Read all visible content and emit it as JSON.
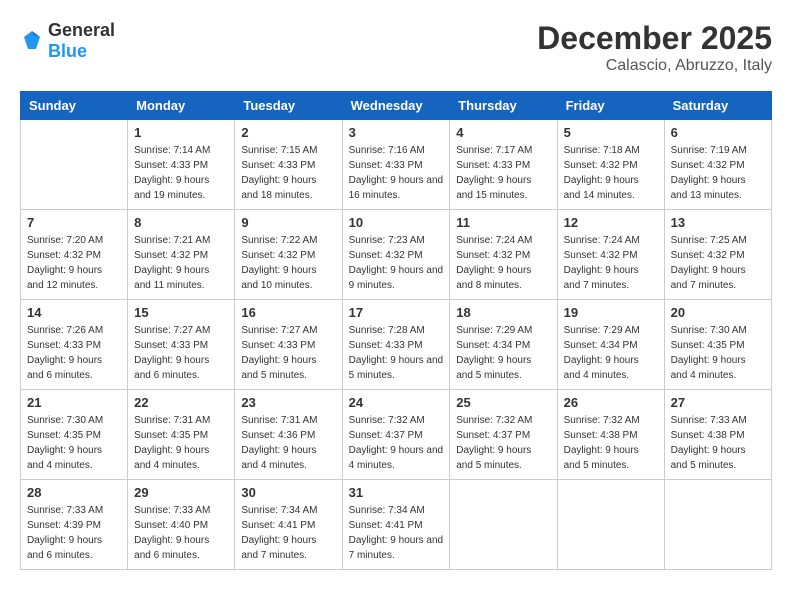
{
  "logo": {
    "general": "General",
    "blue": "Blue"
  },
  "title": "December 2025",
  "location": "Calascio, Abruzzo, Italy",
  "days_of_week": [
    "Sunday",
    "Monday",
    "Tuesday",
    "Wednesday",
    "Thursday",
    "Friday",
    "Saturday"
  ],
  "weeks": [
    [
      {
        "day": "",
        "sunrise": "",
        "sunset": "",
        "daylight": ""
      },
      {
        "day": "1",
        "sunrise": "Sunrise: 7:14 AM",
        "sunset": "Sunset: 4:33 PM",
        "daylight": "Daylight: 9 hours and 19 minutes."
      },
      {
        "day": "2",
        "sunrise": "Sunrise: 7:15 AM",
        "sunset": "Sunset: 4:33 PM",
        "daylight": "Daylight: 9 hours and 18 minutes."
      },
      {
        "day": "3",
        "sunrise": "Sunrise: 7:16 AM",
        "sunset": "Sunset: 4:33 PM",
        "daylight": "Daylight: 9 hours and 16 minutes."
      },
      {
        "day": "4",
        "sunrise": "Sunrise: 7:17 AM",
        "sunset": "Sunset: 4:33 PM",
        "daylight": "Daylight: 9 hours and 15 minutes."
      },
      {
        "day": "5",
        "sunrise": "Sunrise: 7:18 AM",
        "sunset": "Sunset: 4:32 PM",
        "daylight": "Daylight: 9 hours and 14 minutes."
      },
      {
        "day": "6",
        "sunrise": "Sunrise: 7:19 AM",
        "sunset": "Sunset: 4:32 PM",
        "daylight": "Daylight: 9 hours and 13 minutes."
      }
    ],
    [
      {
        "day": "7",
        "sunrise": "Sunrise: 7:20 AM",
        "sunset": "Sunset: 4:32 PM",
        "daylight": "Daylight: 9 hours and 12 minutes."
      },
      {
        "day": "8",
        "sunrise": "Sunrise: 7:21 AM",
        "sunset": "Sunset: 4:32 PM",
        "daylight": "Daylight: 9 hours and 11 minutes."
      },
      {
        "day": "9",
        "sunrise": "Sunrise: 7:22 AM",
        "sunset": "Sunset: 4:32 PM",
        "daylight": "Daylight: 9 hours and 10 minutes."
      },
      {
        "day": "10",
        "sunrise": "Sunrise: 7:23 AM",
        "sunset": "Sunset: 4:32 PM",
        "daylight": "Daylight: 9 hours and 9 minutes."
      },
      {
        "day": "11",
        "sunrise": "Sunrise: 7:24 AM",
        "sunset": "Sunset: 4:32 PM",
        "daylight": "Daylight: 9 hours and 8 minutes."
      },
      {
        "day": "12",
        "sunrise": "Sunrise: 7:24 AM",
        "sunset": "Sunset: 4:32 PM",
        "daylight": "Daylight: 9 hours and 7 minutes."
      },
      {
        "day": "13",
        "sunrise": "Sunrise: 7:25 AM",
        "sunset": "Sunset: 4:32 PM",
        "daylight": "Daylight: 9 hours and 7 minutes."
      }
    ],
    [
      {
        "day": "14",
        "sunrise": "Sunrise: 7:26 AM",
        "sunset": "Sunset: 4:33 PM",
        "daylight": "Daylight: 9 hours and 6 minutes."
      },
      {
        "day": "15",
        "sunrise": "Sunrise: 7:27 AM",
        "sunset": "Sunset: 4:33 PM",
        "daylight": "Daylight: 9 hours and 6 minutes."
      },
      {
        "day": "16",
        "sunrise": "Sunrise: 7:27 AM",
        "sunset": "Sunset: 4:33 PM",
        "daylight": "Daylight: 9 hours and 5 minutes."
      },
      {
        "day": "17",
        "sunrise": "Sunrise: 7:28 AM",
        "sunset": "Sunset: 4:33 PM",
        "daylight": "Daylight: 9 hours and 5 minutes."
      },
      {
        "day": "18",
        "sunrise": "Sunrise: 7:29 AM",
        "sunset": "Sunset: 4:34 PM",
        "daylight": "Daylight: 9 hours and 5 minutes."
      },
      {
        "day": "19",
        "sunrise": "Sunrise: 7:29 AM",
        "sunset": "Sunset: 4:34 PM",
        "daylight": "Daylight: 9 hours and 4 minutes."
      },
      {
        "day": "20",
        "sunrise": "Sunrise: 7:30 AM",
        "sunset": "Sunset: 4:35 PM",
        "daylight": "Daylight: 9 hours and 4 minutes."
      }
    ],
    [
      {
        "day": "21",
        "sunrise": "Sunrise: 7:30 AM",
        "sunset": "Sunset: 4:35 PM",
        "daylight": "Daylight: 9 hours and 4 minutes."
      },
      {
        "day": "22",
        "sunrise": "Sunrise: 7:31 AM",
        "sunset": "Sunset: 4:35 PM",
        "daylight": "Daylight: 9 hours and 4 minutes."
      },
      {
        "day": "23",
        "sunrise": "Sunrise: 7:31 AM",
        "sunset": "Sunset: 4:36 PM",
        "daylight": "Daylight: 9 hours and 4 minutes."
      },
      {
        "day": "24",
        "sunrise": "Sunrise: 7:32 AM",
        "sunset": "Sunset: 4:37 PM",
        "daylight": "Daylight: 9 hours and 4 minutes."
      },
      {
        "day": "25",
        "sunrise": "Sunrise: 7:32 AM",
        "sunset": "Sunset: 4:37 PM",
        "daylight": "Daylight: 9 hours and 5 minutes."
      },
      {
        "day": "26",
        "sunrise": "Sunrise: 7:32 AM",
        "sunset": "Sunset: 4:38 PM",
        "daylight": "Daylight: 9 hours and 5 minutes."
      },
      {
        "day": "27",
        "sunrise": "Sunrise: 7:33 AM",
        "sunset": "Sunset: 4:38 PM",
        "daylight": "Daylight: 9 hours and 5 minutes."
      }
    ],
    [
      {
        "day": "28",
        "sunrise": "Sunrise: 7:33 AM",
        "sunset": "Sunset: 4:39 PM",
        "daylight": "Daylight: 9 hours and 6 minutes."
      },
      {
        "day": "29",
        "sunrise": "Sunrise: 7:33 AM",
        "sunset": "Sunset: 4:40 PM",
        "daylight": "Daylight: 9 hours and 6 minutes."
      },
      {
        "day": "30",
        "sunrise": "Sunrise: 7:34 AM",
        "sunset": "Sunset: 4:41 PM",
        "daylight": "Daylight: 9 hours and 7 minutes."
      },
      {
        "day": "31",
        "sunrise": "Sunrise: 7:34 AM",
        "sunset": "Sunset: 4:41 PM",
        "daylight": "Daylight: 9 hours and 7 minutes."
      },
      {
        "day": "",
        "sunrise": "",
        "sunset": "",
        "daylight": ""
      },
      {
        "day": "",
        "sunrise": "",
        "sunset": "",
        "daylight": ""
      },
      {
        "day": "",
        "sunrise": "",
        "sunset": "",
        "daylight": ""
      }
    ]
  ]
}
